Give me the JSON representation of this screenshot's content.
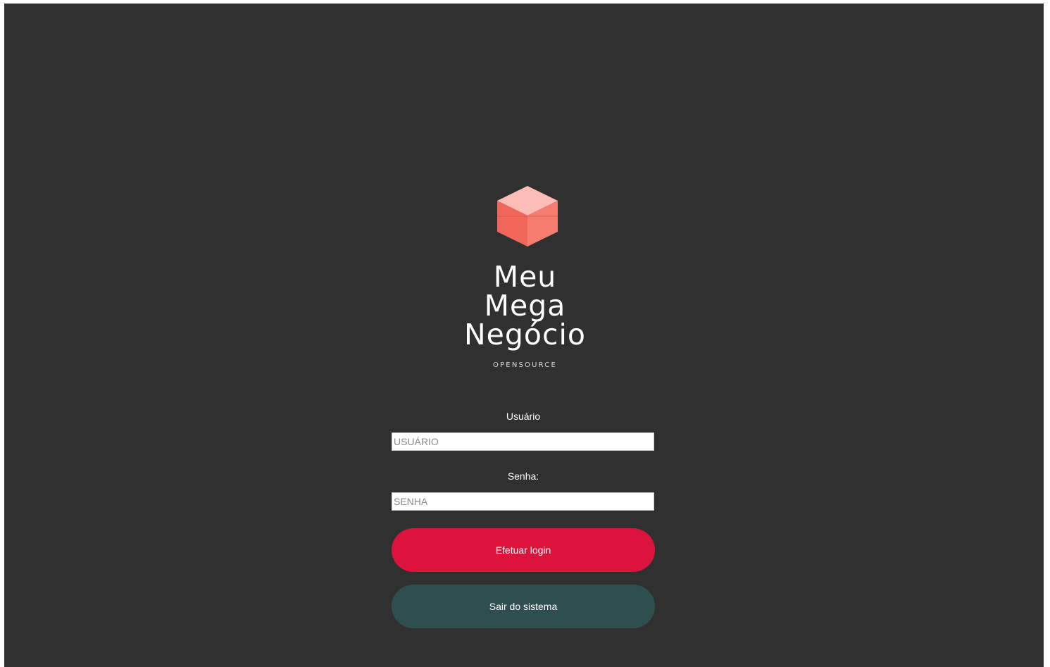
{
  "brand": {
    "line1": "Meu",
    "line2": "Mega",
    "line3": "Negócio",
    "subtitle": "OPENSOURCE",
    "logo_icon": "cube-icon"
  },
  "login_form": {
    "user_label": "Usuário",
    "user_placeholder": "USUÁRIO",
    "user_value": "",
    "password_label": "Senha:",
    "password_placeholder": "SENHA",
    "password_value": "",
    "login_button_label": "Efetuar login",
    "exit_button_label": "Sair do sistema"
  },
  "colors": {
    "background": "#303030",
    "login_button": "#dc143c",
    "exit_button": "#2f4f4f",
    "logo_top": "#fbbdb6",
    "logo_left": "#f1675a",
    "logo_right": "#f47d70"
  }
}
